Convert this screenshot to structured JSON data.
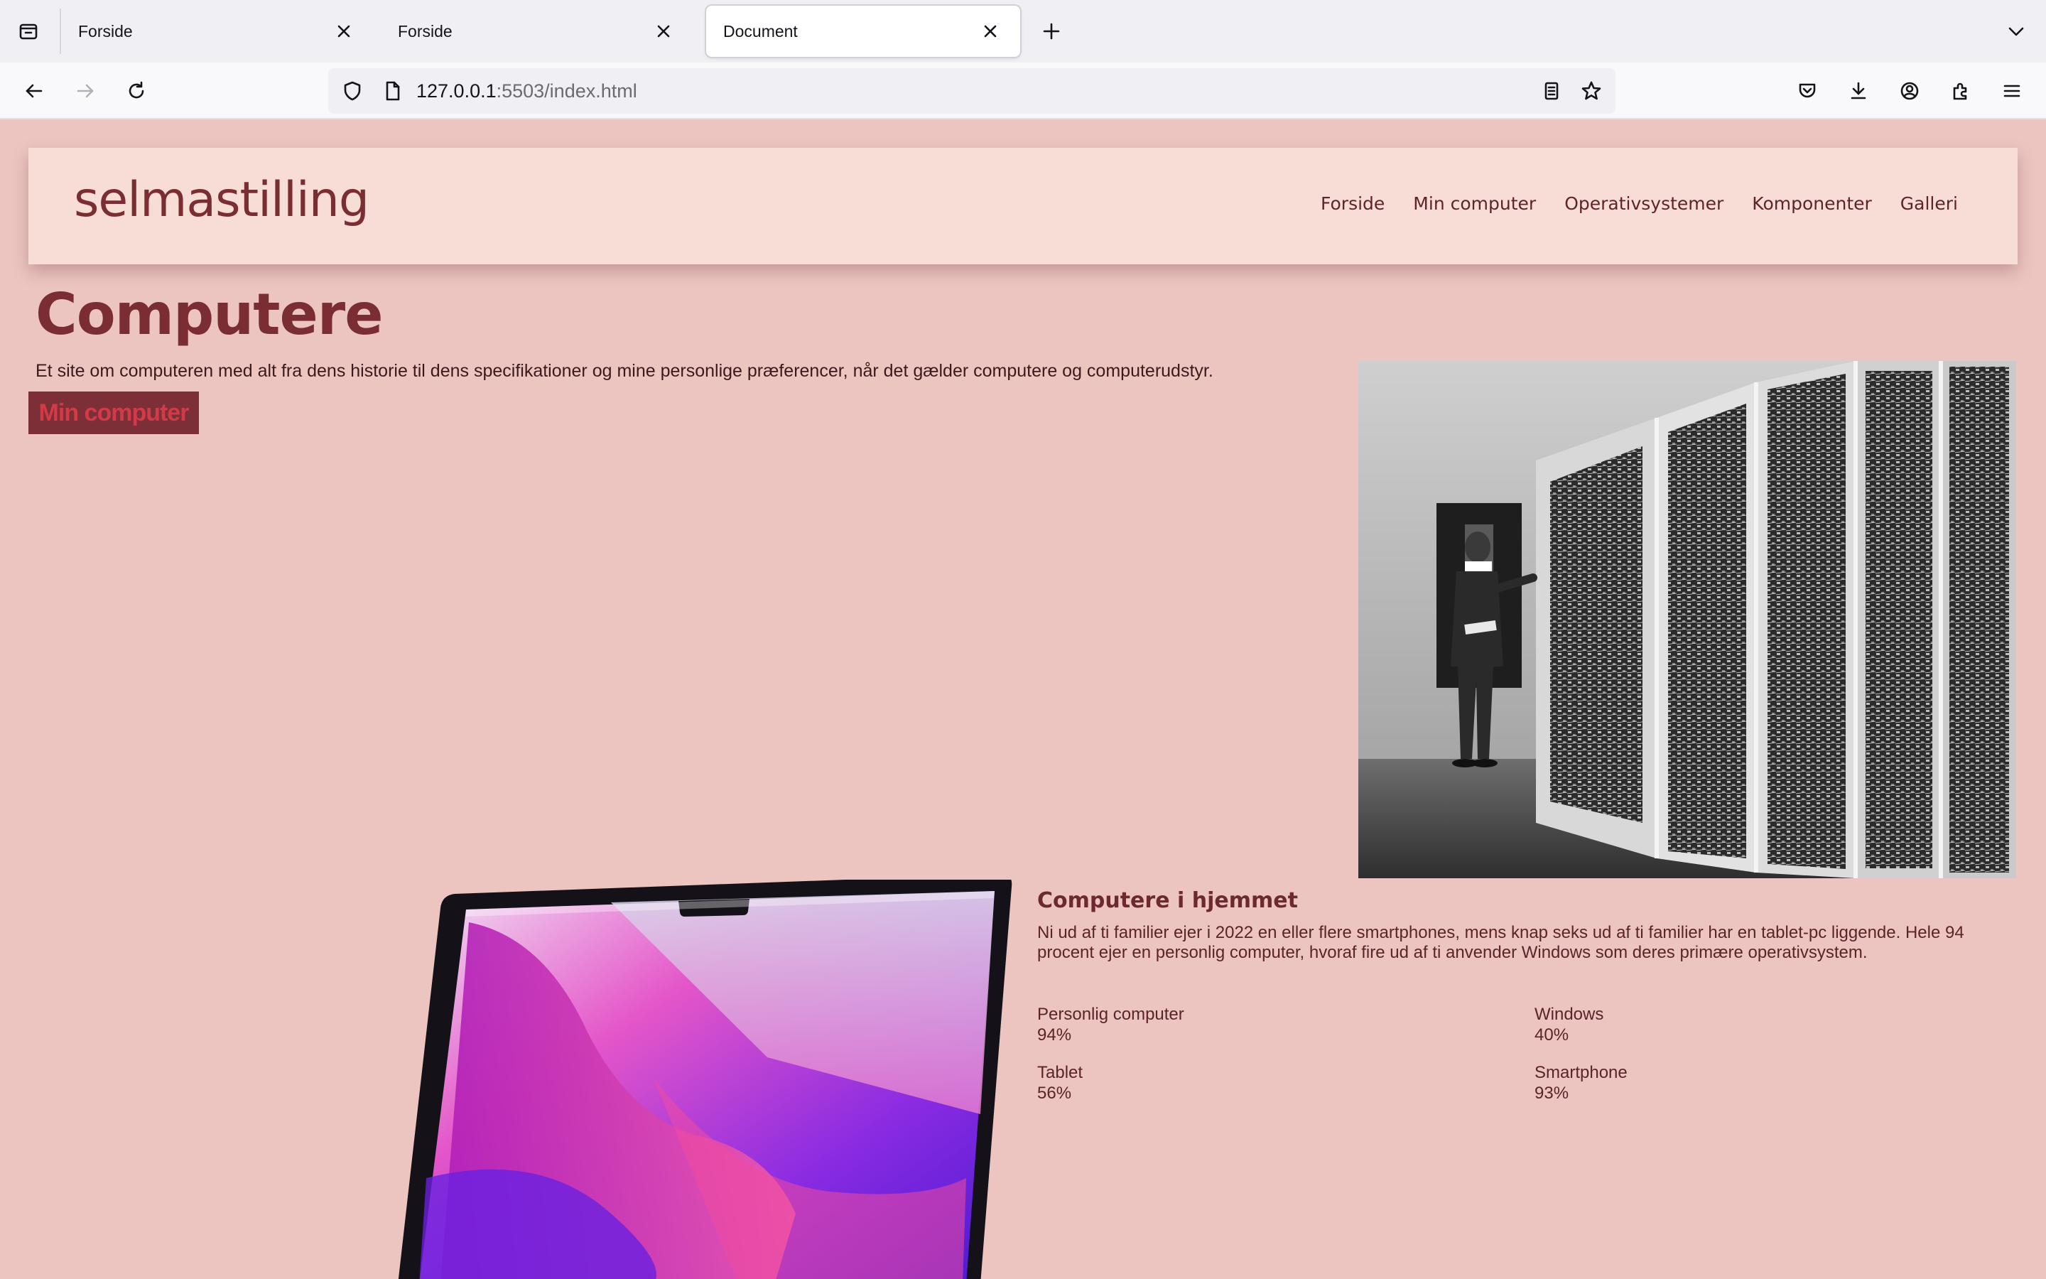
{
  "browser": {
    "tabs": [
      {
        "title": "Forside"
      },
      {
        "title": "Forside"
      },
      {
        "title": "Document"
      }
    ],
    "url": {
      "host": "127.0.0.1",
      "rest": ":5503/index.html"
    }
  },
  "site": {
    "logo": "selmastilling",
    "nav": [
      "Forside",
      "Min computer",
      "Operativsystemer",
      "Komponenter",
      "Galleri"
    ],
    "hero": {
      "title": "Computere",
      "text": "Et site om computeren med alt fra dens historie til dens specifikationer og mine personlige præferencer, når det gælder computere og computerudstyr.",
      "button": "Min computer"
    },
    "home": {
      "title": "Computere i hjemmet",
      "text": "Ni ud af ti familier ejer i 2022 en eller flere smartphones, mens knap seks ud af ti familier har en tablet-pc liggende. Hele 94 procent ejer en personlig computer, hvoraf fire ud af ti anvender Windows som deres primære operativsystem.",
      "stats": [
        {
          "label": "Personlig computer",
          "value": "94%"
        },
        {
          "label": "Windows",
          "value": "40%"
        },
        {
          "label": "Tablet",
          "value": "56%"
        },
        {
          "label": "Smartphone",
          "value": "93%"
        }
      ]
    }
  },
  "colors": {
    "page_background": "#ecc5c1",
    "header_background": "#f8ddd7",
    "accent_dark": "#7a2e34",
    "button_background": "#7c2f36",
    "button_text": "#d23a48"
  }
}
